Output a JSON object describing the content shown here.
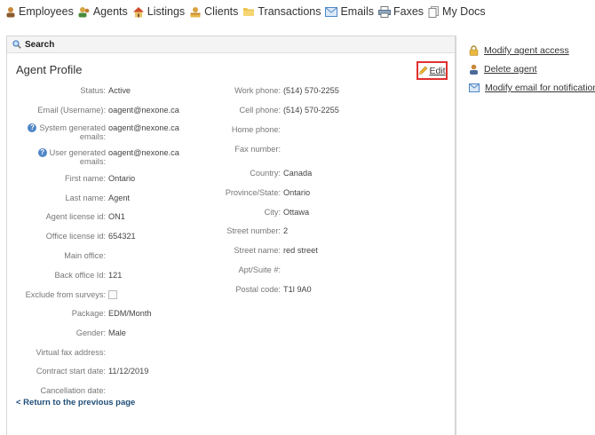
{
  "nav": {
    "employees": "Employees",
    "agents": "Agents",
    "listings": "Listings",
    "clients": "Clients",
    "transactions": "Transactions",
    "emails": "Emails",
    "faxes": "Faxes",
    "my_docs": "My Docs"
  },
  "search": {
    "label": "Search"
  },
  "profile": {
    "title": "Agent Profile",
    "edit_label": "Edit",
    "left": {
      "status": {
        "label": "Status:",
        "value": "Active"
      },
      "email": {
        "label": "Email (Username):",
        "value": "oagent@nexone.ca"
      },
      "system_emails": {
        "label_line1": "System generated",
        "label_line2": "emails:",
        "value": "oagent@nexone.ca"
      },
      "user_emails": {
        "label_line1": "User generated",
        "label_line2": "emails:",
        "value": "oagent@nexone.ca"
      },
      "first_name": {
        "label": "First name:",
        "value": "Ontario"
      },
      "last_name": {
        "label": "Last name:",
        "value": "Agent"
      },
      "agent_license": {
        "label": "Agent license id:",
        "value": "ON1"
      },
      "office_license": {
        "label": "Office license id:",
        "value": "654321"
      },
      "main_office": {
        "label": "Main office:",
        "value": ""
      },
      "back_office": {
        "label": "Back office Id:",
        "value": "121"
      },
      "exclude_surveys": {
        "label": "Exclude from surveys:"
      },
      "package": {
        "label": "Package:",
        "value": "EDM/Month"
      },
      "gender": {
        "label": "Gender:",
        "value": "Male"
      },
      "virtual_fax": {
        "label": "Virtual fax address:",
        "value": ""
      },
      "contract_start": {
        "label": "Contract start date:",
        "value": "11/12/2019"
      },
      "cancellation": {
        "label": "Cancellation date:",
        "value": ""
      }
    },
    "right": {
      "work_phone": {
        "label": "Work phone:",
        "value": "(514) 570-2255"
      },
      "cell_phone": {
        "label": "Cell phone:",
        "value": "(514) 570-2255"
      },
      "home_phone": {
        "label": "Home phone:",
        "value": ""
      },
      "fax_number": {
        "label": "Fax number:",
        "value": ""
      },
      "country": {
        "label": "Country:",
        "value": "Canada"
      },
      "province": {
        "label": "Province/State:",
        "value": "Ontario"
      },
      "city": {
        "label": "City:",
        "value": "Ottawa"
      },
      "street_number": {
        "label": "Street number:",
        "value": "2"
      },
      "street_name": {
        "label": "Street name:",
        "value": "red street"
      },
      "apt_suite": {
        "label": "Apt/Suite #:",
        "value": ""
      },
      "postal_code": {
        "label": "Postal code:",
        "value": "T1l 9A0"
      }
    }
  },
  "return_link": "< Return to the previous page",
  "actions": {
    "modify_access": "Modify agent access",
    "delete_agent": "Delete agent",
    "modify_email": "Modify email for notifications"
  },
  "colors": {
    "accent_link": "#1f4e79",
    "highlight_border": "#e03030",
    "help_icon": "#4f86c6"
  }
}
